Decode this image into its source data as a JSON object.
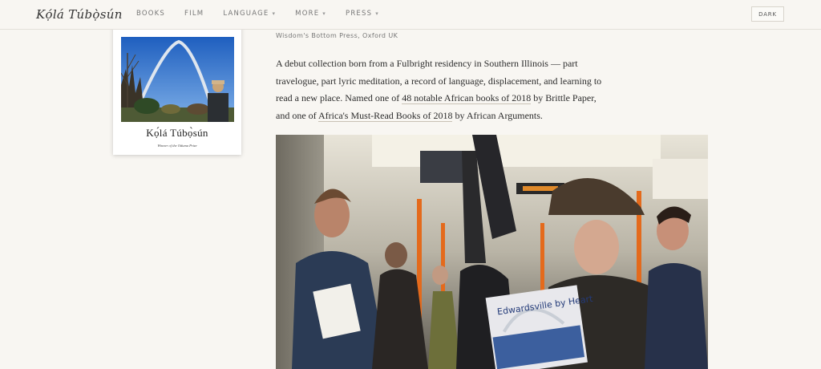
{
  "header": {
    "brand": "Kọ́lá Túbọ̀sún",
    "nav": [
      {
        "label": "BOOKS",
        "dropdown": false
      },
      {
        "label": "FILM",
        "dropdown": false
      },
      {
        "label": "LANGUAGE",
        "dropdown": true
      },
      {
        "label": "MORE",
        "dropdown": true
      },
      {
        "label": "PRESS",
        "dropdown": true
      }
    ],
    "theme_toggle": "DARK"
  },
  "book": {
    "cover_author": "Kọ́lá Túbọ̀sún",
    "cover_subtitle": "Winner of the Oduma Prize",
    "publisher": "Wisdom's Bottom Press, Oxford UK",
    "description": {
      "intro": "A debut collection born from a Fulbright residency in Southern Illinois — part travelogue, part lyric meditation, a record of language, displacement, and learning to read a new place. Named one of ",
      "link1": "48 notable African books of 2018",
      "mid": " by Brittle Paper, and one of ",
      "link2": "Africa's Must-Read Books of 2018",
      "outro": " by African Arguments."
    },
    "photo_book_title": "Edwardsville by Heart"
  },
  "colors": {
    "background": "#f8f6f2",
    "text": "#2c2c2c",
    "muted": "#777777"
  }
}
